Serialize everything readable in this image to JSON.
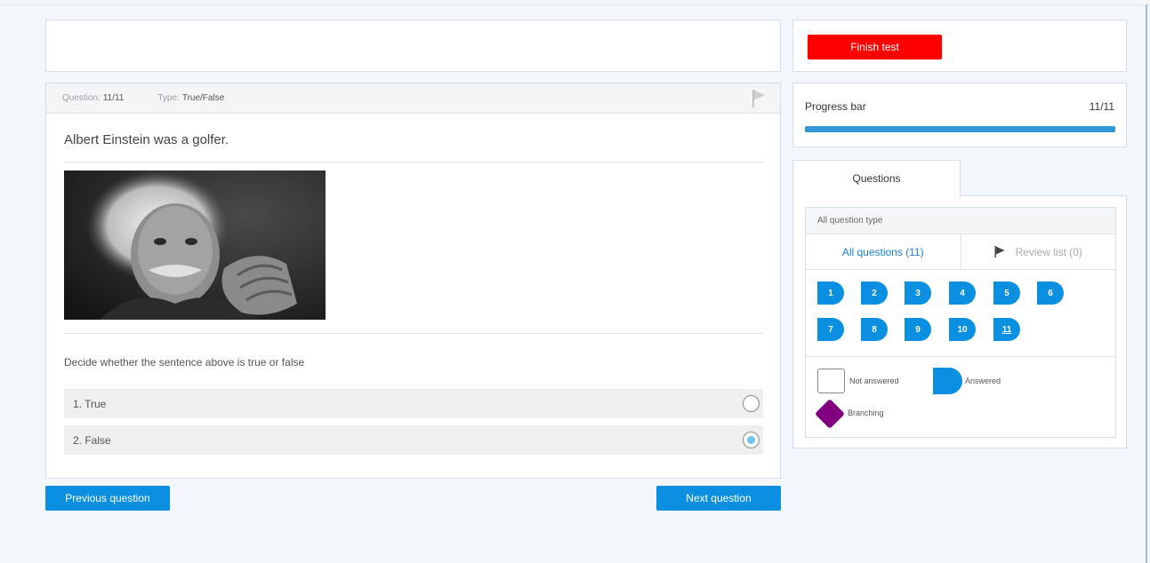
{
  "question": {
    "number_label": "Question:",
    "number_value": "11/11",
    "type_label": "Type:",
    "type_value": "True/False",
    "text": "Albert Einstein was a golfer.",
    "instruction": "Decide whether the sentence above is true or false",
    "options": [
      {
        "label": "1. True",
        "selected": false
      },
      {
        "label": "2. False",
        "selected": true
      }
    ]
  },
  "nav": {
    "prev_label": "Previous question",
    "next_label": "Next question"
  },
  "sidebar": {
    "finish_label": "Finish test",
    "progress_label": "Progress bar",
    "progress_count": "11/11",
    "progress_fraction": 1.0,
    "tab_label": "Questions",
    "filter_label": "All question type",
    "all_questions_label": "All questions (11)",
    "review_list_label": "Review list (0)",
    "question_numbers": [
      "1",
      "2",
      "3",
      "4",
      "5",
      "6",
      "7",
      "8",
      "9",
      "10",
      "11"
    ],
    "current_question": "11",
    "legend": {
      "not_answered": "Not answered",
      "answered": "Answered",
      "branching": "Branching"
    }
  },
  "colors": {
    "accent": "#0b8fe0",
    "finish": "#ff0000",
    "progress": "#3399d6",
    "branching": "#800080"
  }
}
